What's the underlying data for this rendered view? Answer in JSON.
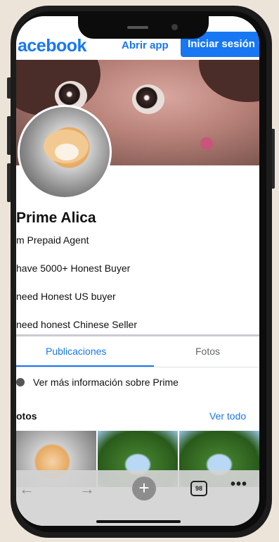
{
  "header": {
    "logo": "acebook",
    "open_app": "Abrir app",
    "login": "Iniciar sesión"
  },
  "profile": {
    "name": "Prime Alica",
    "bio": [
      "m Prepaid Agent",
      "have 5000+ Honest Buyer",
      "need Honest US buyer",
      "need honest Chinese Seller"
    ]
  },
  "tabs": [
    {
      "label": "Publicaciones",
      "active": true
    },
    {
      "label": "Fotos",
      "active": false
    }
  ],
  "more_info": "Ver más información sobre Prime",
  "photos": {
    "title": "otos",
    "see_all": "Ver todo"
  },
  "browser_bar": {
    "back_icon": "←",
    "forward_icon": "→",
    "new_tab_icon": "+",
    "tab_count": "98",
    "menu_icon": "•••"
  },
  "colors": {
    "accent": "#1877f2",
    "frame": "#1c1c1c",
    "background": "#ede4d9"
  }
}
